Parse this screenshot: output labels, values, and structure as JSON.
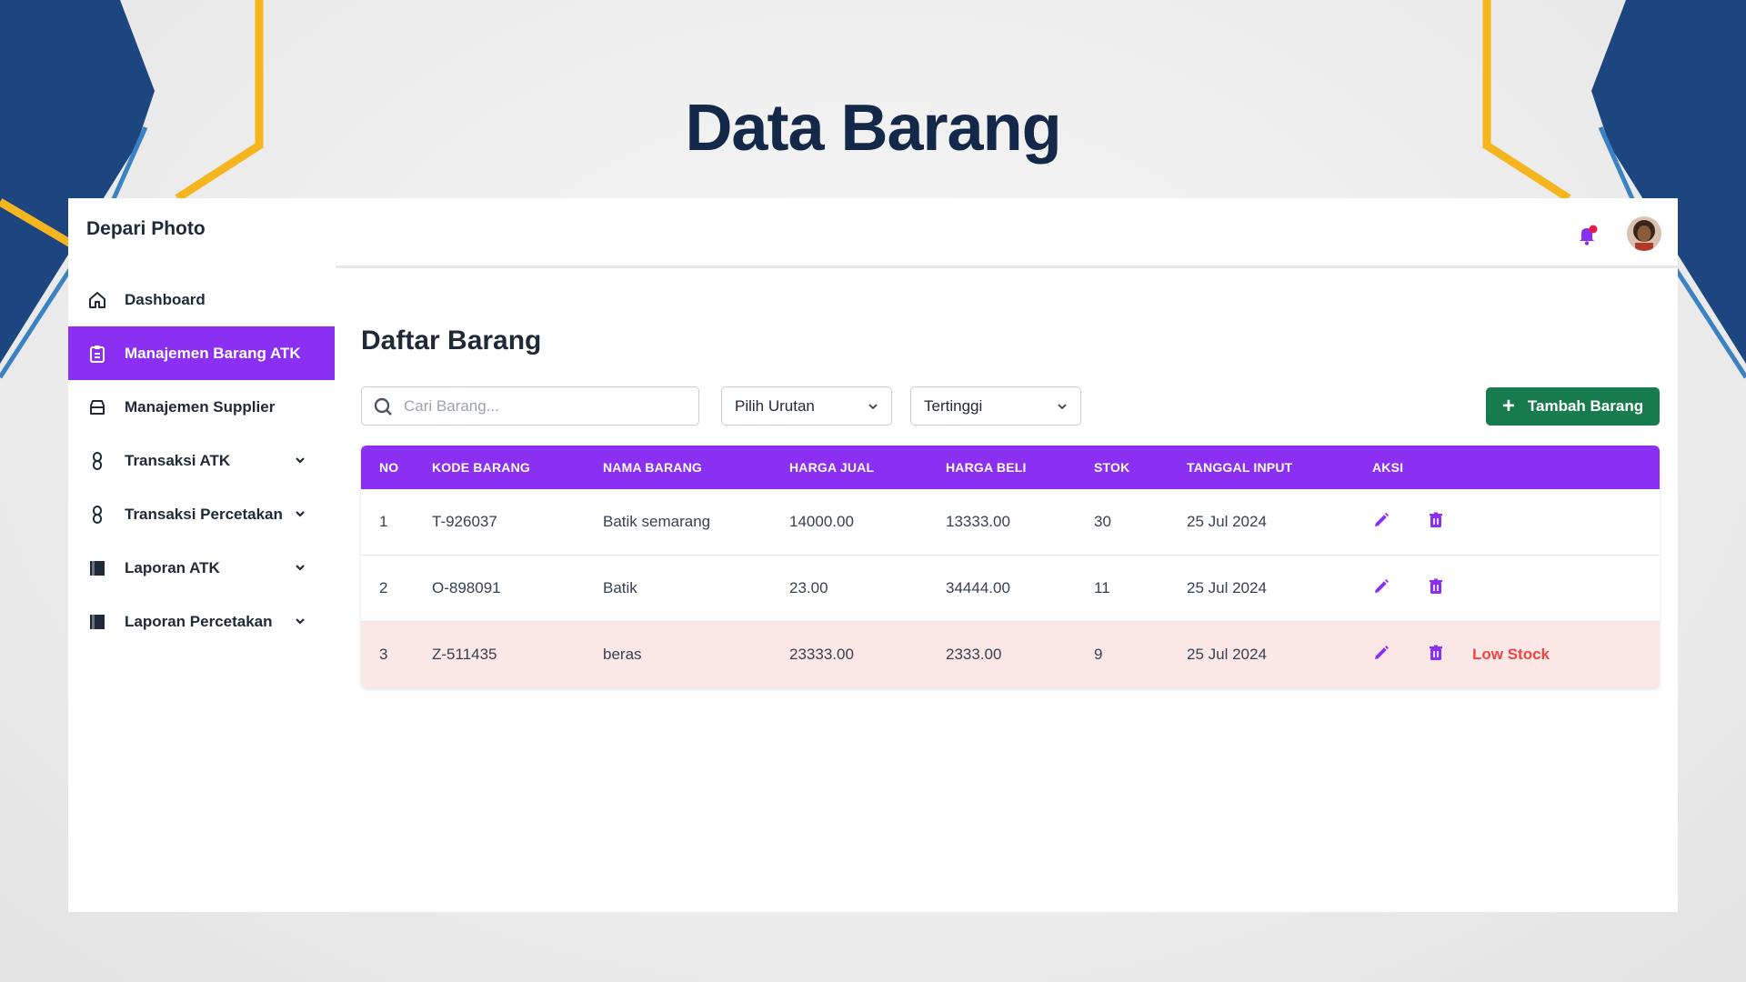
{
  "slide": {
    "title": "Data Barang"
  },
  "app": {
    "brand": "Depari Photo"
  },
  "sidebar": {
    "items": [
      {
        "label": "Dashboard",
        "icon": "home-icon",
        "active": false,
        "expandable": false
      },
      {
        "label": "Manajemen Barang ATK",
        "icon": "clipboard-icon",
        "active": true,
        "expandable": false
      },
      {
        "label": "Manajemen Supplier",
        "icon": "inbox-icon",
        "active": false,
        "expandable": false
      },
      {
        "label": "Transaksi ATK",
        "icon": "link-icon",
        "active": false,
        "expandable": true
      },
      {
        "label": "Transaksi Percetakan",
        "icon": "link-icon",
        "active": false,
        "expandable": true
      },
      {
        "label": "Laporan ATK",
        "icon": "book-icon",
        "active": false,
        "expandable": true
      },
      {
        "label": "Laporan Percetakan",
        "icon": "book-icon",
        "active": false,
        "expandable": true
      }
    ]
  },
  "main": {
    "heading": "Daftar Barang",
    "search": {
      "placeholder": "Cari Barang...",
      "value": ""
    },
    "sort_select": {
      "value": "Pilih Urutan"
    },
    "order_select": {
      "value": "Tertinggi"
    },
    "add_button": {
      "label": "Tambah Barang"
    }
  },
  "table": {
    "headers": [
      "NO",
      "KODE BARANG",
      "NAMA BARANG",
      "HARGA JUAL",
      "HARGA BELI",
      "STOK",
      "TANGGAL INPUT",
      "AKSI"
    ],
    "rows": [
      {
        "no": "1",
        "kode": "T-926037",
        "nama": "Batik semarang",
        "jual": "14000.00",
        "beli": "13333.00",
        "stok": "30",
        "tanggal": "25 Jul 2024",
        "status": ""
      },
      {
        "no": "2",
        "kode": "O-898091",
        "nama": "Batik",
        "jual": "23.00",
        "beli": "34444.00",
        "stok": "11",
        "tanggal": "25 Jul 2024",
        "status": ""
      },
      {
        "no": "3",
        "kode": "Z-511435",
        "nama": "beras",
        "jual": "23333.00",
        "beli": "2333.00",
        "stok": "9",
        "tanggal": "25 Jul 2024",
        "status": "Low Stock"
      }
    ]
  },
  "colors": {
    "accent": "#8b30f2",
    "add_button": "#177b4e",
    "low_stock_row": "#fce7e7",
    "low_stock_text": "#ef4444",
    "slide_title": "#14284a",
    "notification_dot": "#e11d48"
  }
}
